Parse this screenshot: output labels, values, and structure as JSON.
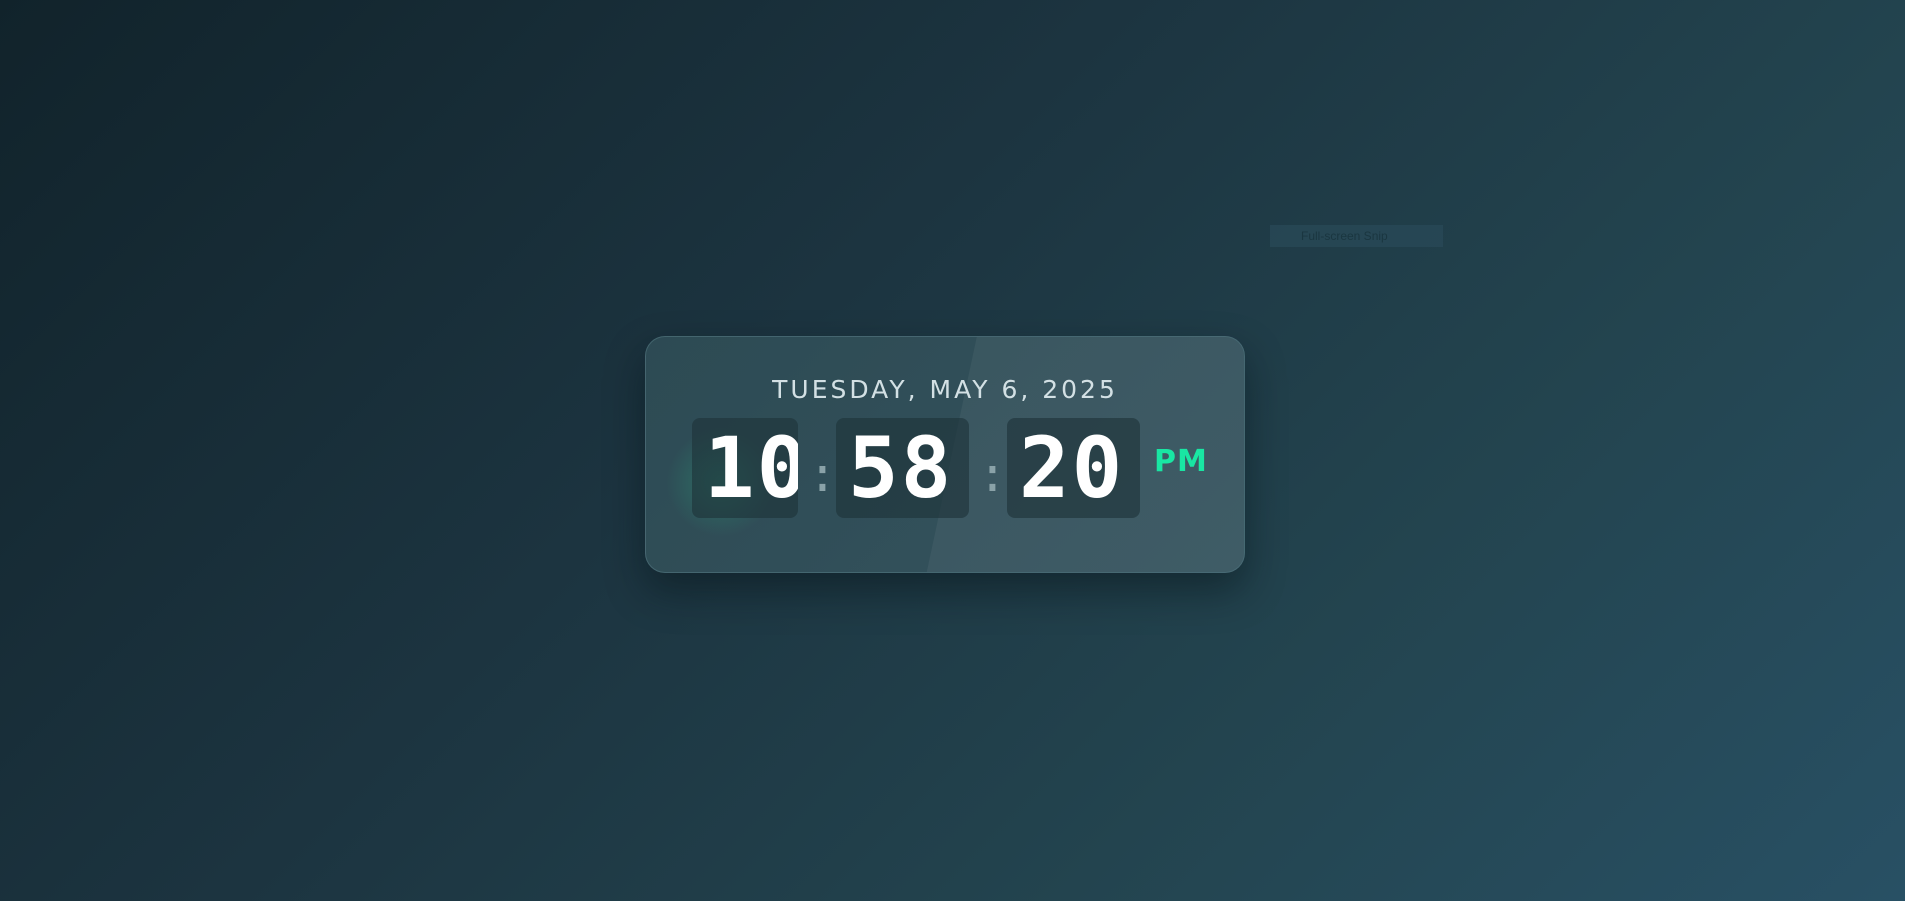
{
  "snip": {
    "label": "Full-screen Snip"
  },
  "clock": {
    "date": "TUESDAY, MAY 6, 2025",
    "hours": "10",
    "minutes": "58",
    "seconds": "20",
    "separator": ":",
    "period": "PM"
  },
  "colors": {
    "accent": "#19e6a3",
    "digit": "#ffffff",
    "date_text": "#d3e0e4",
    "background_start": "#11232b",
    "background_end": "#285064"
  }
}
